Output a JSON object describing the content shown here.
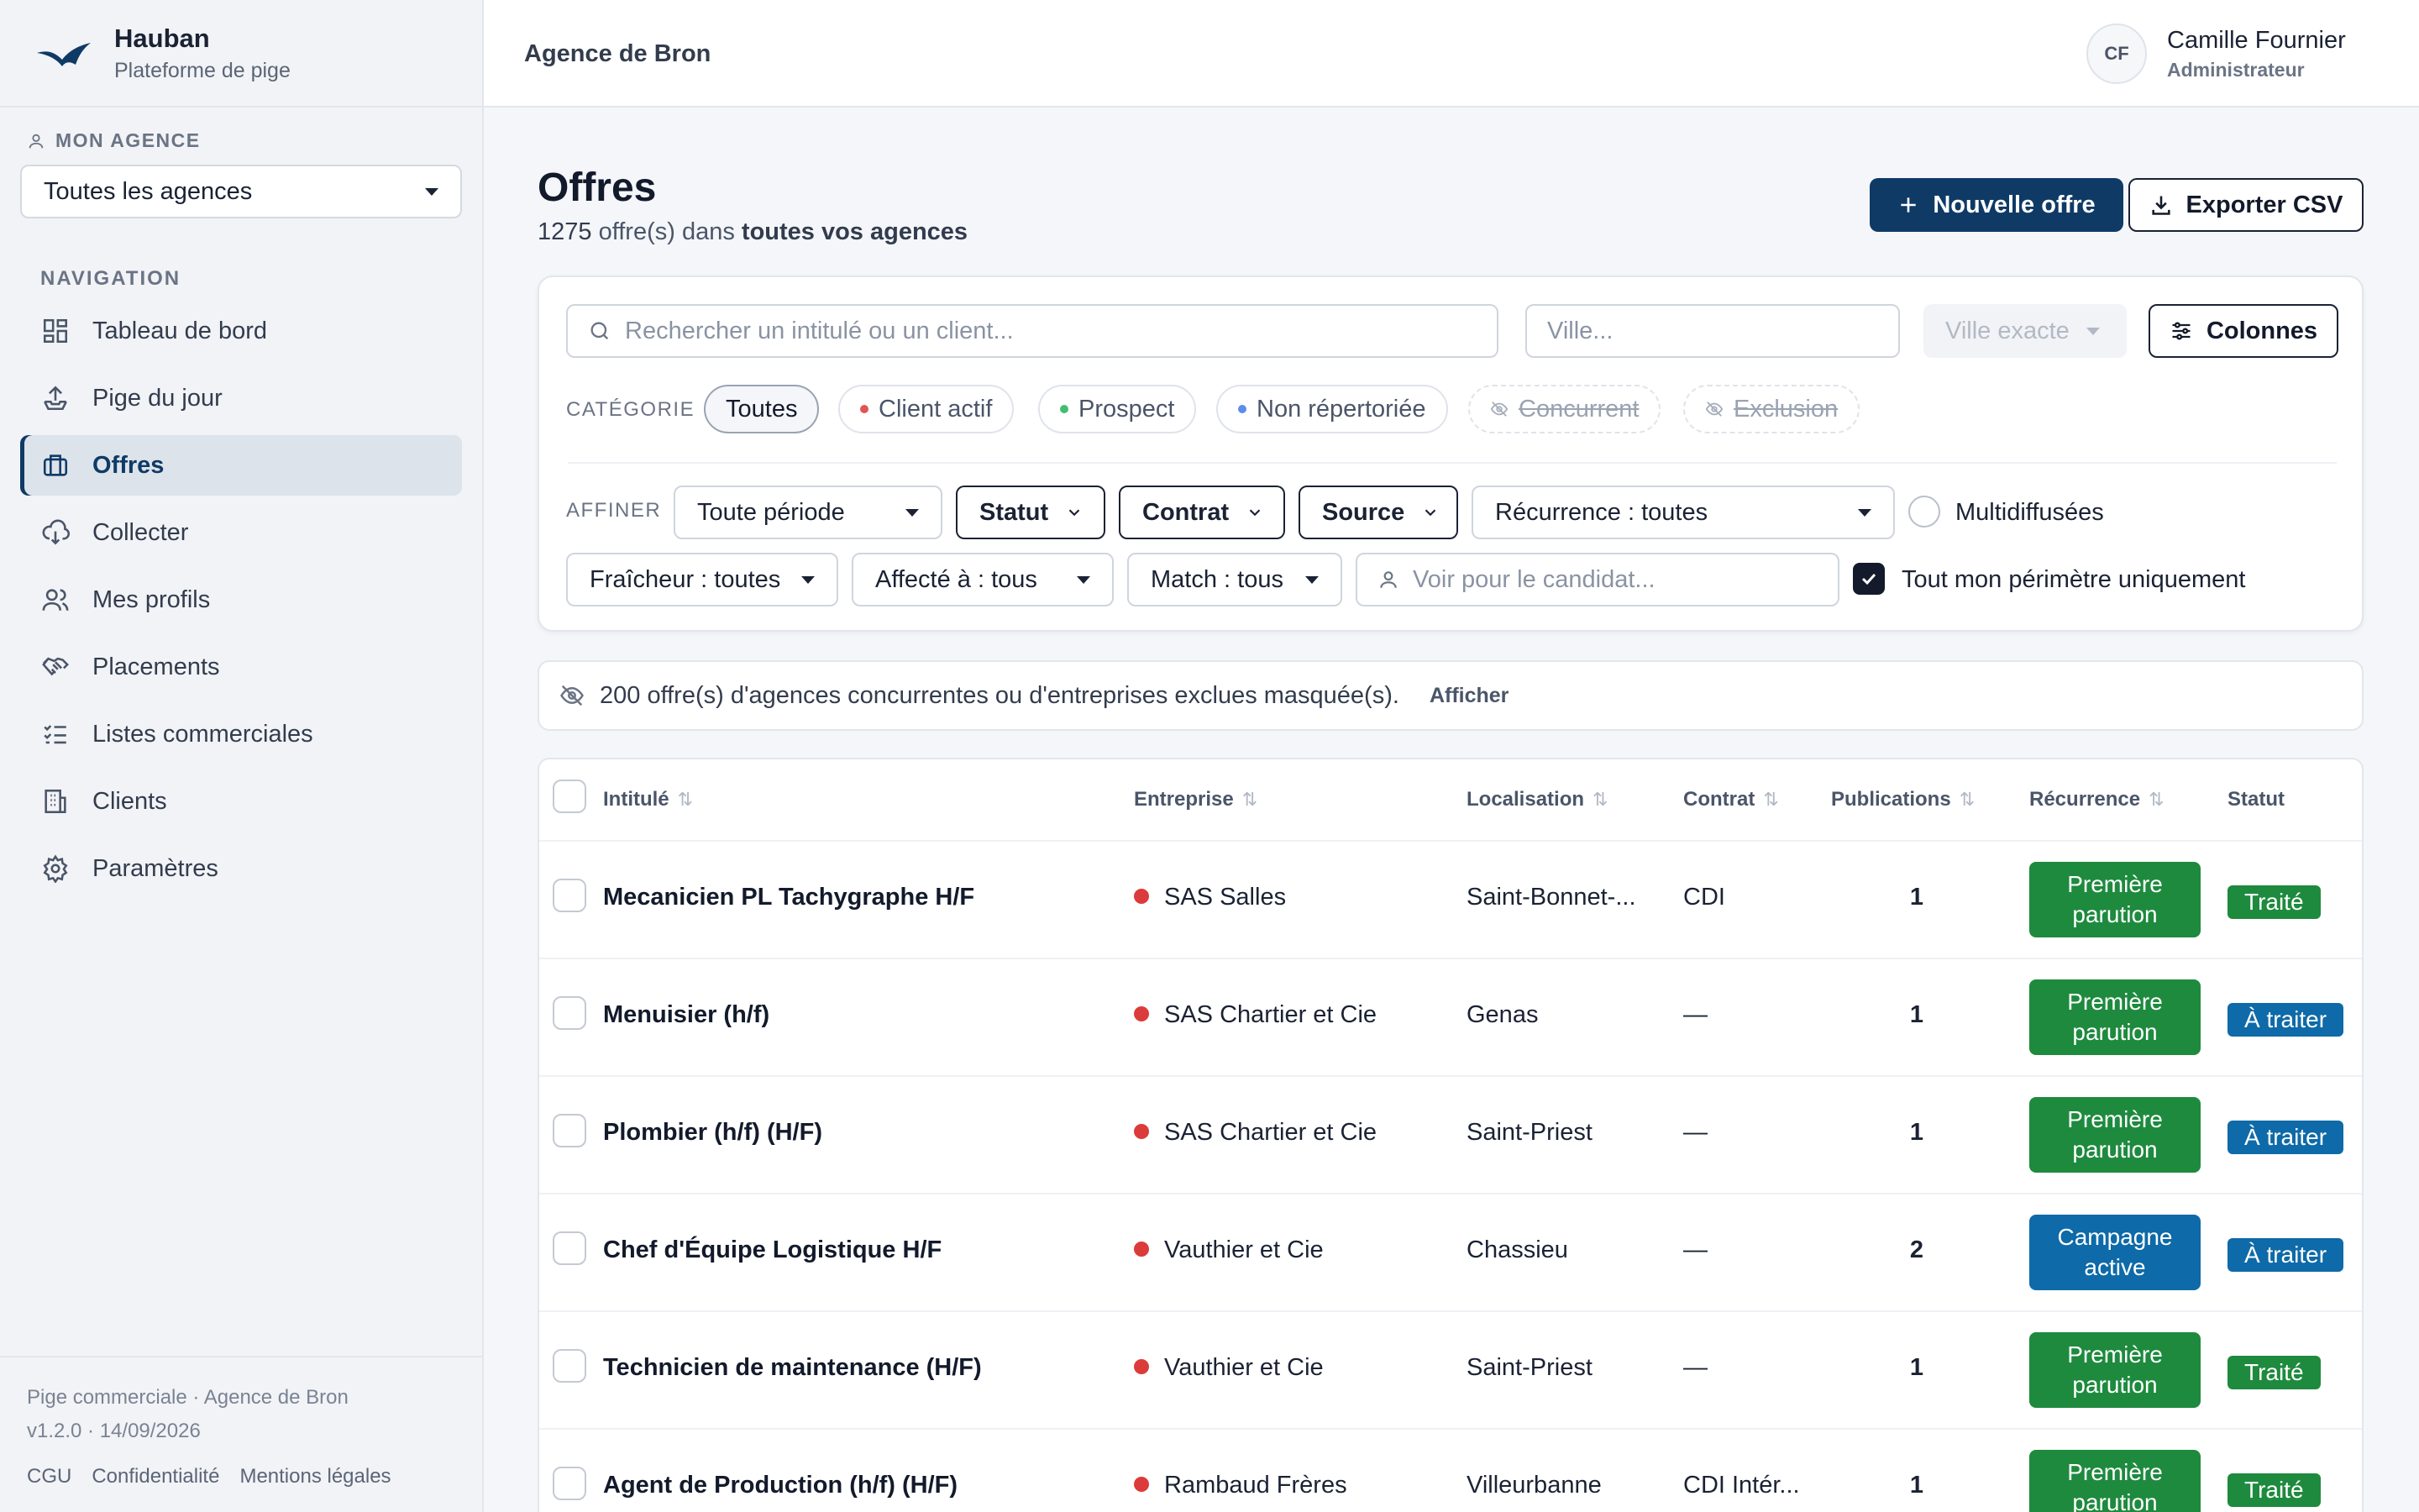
{
  "brand": {
    "name": "Hauban",
    "subtitle": "Plateforme de pige"
  },
  "sidebar": {
    "agency_label": "MON AGENCE",
    "agency_select": "Toutes les agences",
    "nav_label": "NAVIGATION",
    "items": [
      {
        "label": "Tableau de bord",
        "icon": "dashboard-icon"
      },
      {
        "label": "Pige du jour",
        "icon": "upload-tray-icon"
      },
      {
        "label": "Offres",
        "icon": "briefcase-icon",
        "active": true
      },
      {
        "label": "Collecter",
        "icon": "cloud-download-icon"
      },
      {
        "label": "Mes profils",
        "icon": "users-icon"
      },
      {
        "label": "Placements",
        "icon": "handshake-icon"
      },
      {
        "label": "Listes commerciales",
        "icon": "checklist-icon"
      },
      {
        "label": "Clients",
        "icon": "building-icon"
      },
      {
        "label": "Paramètres",
        "icon": "gear-icon"
      }
    ],
    "footer": {
      "line1": "Pige commerciale · Agence de Bron",
      "line2": "v1.2.0 · 14/09/2026",
      "links": [
        "CGU",
        "Confidentialité",
        "Mentions légales"
      ]
    }
  },
  "topbar": {
    "agency": "Agence de Bron",
    "user_initials": "CF",
    "user_name": "Camille Fournier",
    "user_role": "Administrateur"
  },
  "header": {
    "title": "Offres",
    "count": "1275",
    "sub_mid": " offre(s) dans ",
    "sub_end": "toutes vos agences",
    "new_offer": "Nouvelle offre",
    "export": "Exporter CSV"
  },
  "filters": {
    "search_placeholder": "Rechercher un intitulé ou un client...",
    "city_placeholder": "Ville...",
    "exact_city": "Ville exacte",
    "columns_button": "Colonnes",
    "category_label": "CATÉGORIE",
    "categories": [
      "Toutes",
      "Client actif",
      "Prospect",
      "Non répertoriée",
      "Concurrent",
      "Exclusion"
    ],
    "category_colors": {
      "client_actif": "#e45454",
      "prospect": "#3fbf6f",
      "non_repertoriee": "#5b8def"
    },
    "refine_label": "AFFINER",
    "period": "Toute période",
    "statut": "Statut",
    "contrat": "Contrat",
    "source": "Source",
    "recurrence": "Récurrence : toutes",
    "multidiffusees": "Multidiffusées",
    "fraicheur": "Fraîcheur : toutes",
    "affecte": "Affecté à : tous",
    "match": "Match : tous",
    "candidate_placeholder": "Voir pour le candidat...",
    "perimetre": "Tout mon périmètre uniquement"
  },
  "notice": {
    "text": "200 offre(s) d'agences concurrentes ou d'entreprises exclues masquée(s).",
    "action": "Afficher"
  },
  "table": {
    "columns": [
      "Intitulé",
      "Entreprise",
      "Localisation",
      "Contrat",
      "Publications",
      "Récurrence",
      "Statut"
    ],
    "rows": [
      {
        "title": "Mecanicien PL Tachygraphe H/F",
        "company": "SAS Salles",
        "location": "Saint-Bonnet-...",
        "contract": "CDI",
        "publications": "1",
        "recurrence": "Première parution",
        "status": "Traité"
      },
      {
        "title": "Menuisier (h/f)",
        "company": "SAS Chartier et Cie",
        "location": "Genas",
        "contract": "—",
        "publications": "1",
        "recurrence": "Première parution",
        "status": "À traiter"
      },
      {
        "title": "Plombier (h/f) (H/F)",
        "company": "SAS Chartier et Cie",
        "location": "Saint-Priest",
        "contract": "—",
        "publications": "1",
        "recurrence": "Première parution",
        "status": "À traiter"
      },
      {
        "title": "Chef d'Équipe Logistique H/F",
        "company": "Vauthier et Cie",
        "location": "Chassieu",
        "contract": "—",
        "publications": "2",
        "recurrence": "Campagne active",
        "status": "À traiter"
      },
      {
        "title": "Technicien de maintenance (H/F)",
        "company": "Vauthier et Cie",
        "location": "Saint-Priest",
        "contract": "—",
        "publications": "1",
        "recurrence": "Première parution",
        "status": "Traité"
      },
      {
        "title": "Agent de Production (h/f) (H/F)",
        "company": "Rambaud Frères",
        "location": "Villeurbanne",
        "contract": "CDI Intér...",
        "publications": "1",
        "recurrence": "Première parution",
        "status": "Traité"
      }
    ]
  },
  "colors": {
    "primary": "#0f3a66",
    "green_badge": "#1e8a3e",
    "blue_badge": "#0e6aa8",
    "company_dot": "#dc3b3b"
  }
}
